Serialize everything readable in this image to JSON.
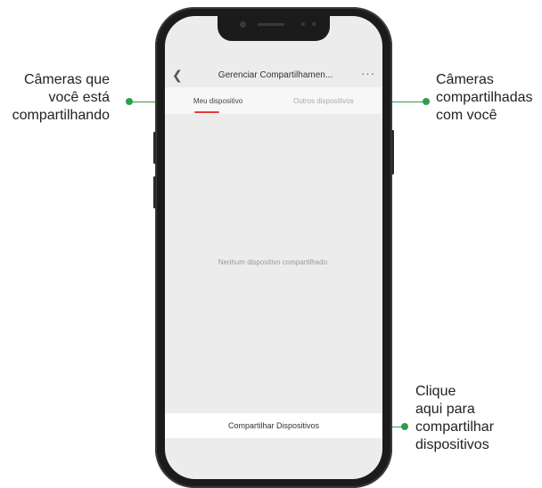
{
  "annotations": {
    "left": [
      "Câmeras que",
      "você está",
      "compartilhando"
    ],
    "right": [
      "Câmeras",
      "compartilhadas",
      "com você"
    ],
    "bottom": [
      "Clique",
      "aqui para",
      "compartilhar",
      "dispositivos"
    ]
  },
  "colors": {
    "accent_green": "#2e9e4a",
    "tab_indicator": "#e33b3b",
    "phone_body": "#1b1b1b",
    "screen_bg": "#ececec"
  },
  "app": {
    "back_icon": "chevron-left-icon",
    "title": "Gerenciar Compartilhamen...",
    "more_icon": "ellipsis-icon",
    "tabs": [
      {
        "label": "Meu dispositivo",
        "active": true
      },
      {
        "label": "Outros dispositivos",
        "active": false
      }
    ],
    "empty_message": "Nenhum dispositivo compartilhado.",
    "share_button_label": "Compartilhar Dispositivos"
  }
}
